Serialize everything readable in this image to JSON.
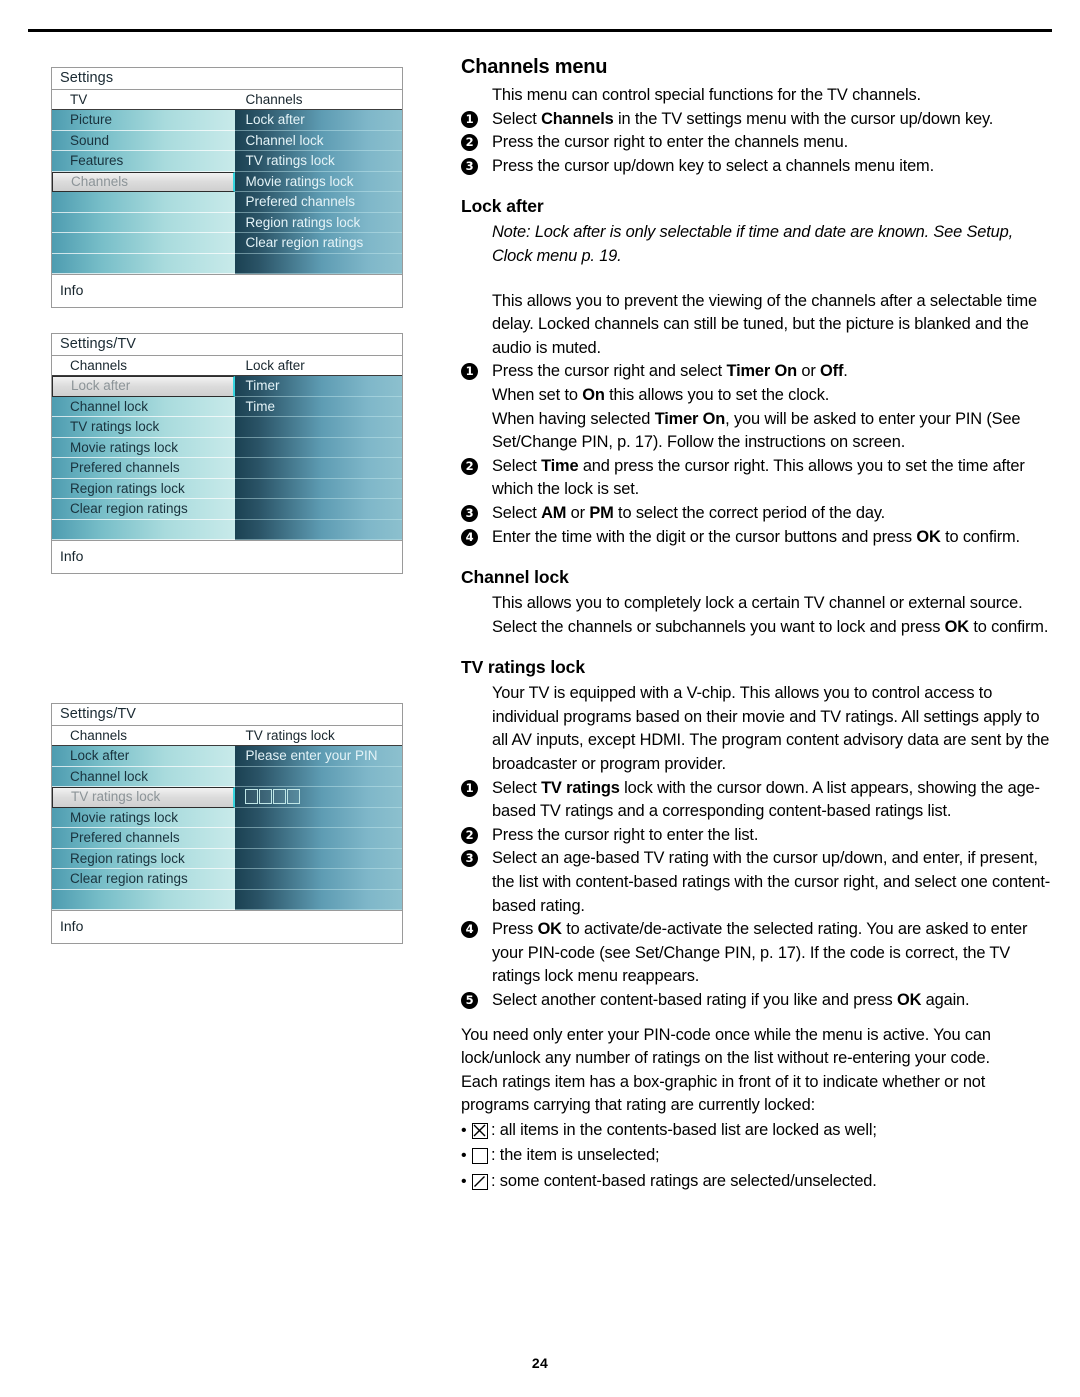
{
  "page": {
    "number": "24"
  },
  "osd_screens": [
    {
      "title": "Settings",
      "left_header": "TV",
      "right_header": "Channels",
      "left_items": [
        "Picture",
        "Sound",
        "Features",
        "Channels",
        "",
        "",
        "",
        ""
      ],
      "left_selected_index": 3,
      "right_items": [
        "Lock after",
        "Channel lock",
        "TV ratings lock",
        "Movie ratings lock",
        "Prefered channels",
        "Region ratings lock",
        "Clear region ratings",
        ""
      ],
      "info_label": "Info"
    },
    {
      "title": "Settings/TV",
      "left_header": "Channels",
      "right_header": "Lock after",
      "left_items": [
        "Lock after",
        "Channel lock",
        "TV ratings lock",
        "Movie ratings lock",
        "Prefered channels",
        "Region ratings lock",
        "Clear region ratings",
        ""
      ],
      "left_selected_index": 0,
      "right_items": [
        "Timer",
        "Time",
        "",
        "",
        "",
        "",
        "",
        ""
      ],
      "info_label": "Info"
    },
    {
      "title": "Settings/TV",
      "left_header": "Channels",
      "right_header": "TV ratings lock",
      "left_items": [
        "Lock after",
        "Channel lock",
        "TV ratings lock",
        "Movie ratings lock",
        "Prefered channels",
        "Region ratings lock",
        "Clear region ratings",
        ""
      ],
      "left_selected_index": 2,
      "right_items": [
        "Please enter your PIN",
        "",
        "PIN_BOXES",
        "",
        "",
        "",
        "",
        ""
      ],
      "pin_box_count": 4,
      "info_label": "Info"
    }
  ],
  "content": {
    "heading": "Channels menu",
    "intro": "This menu can control special functions for the TV channels.",
    "intro_steps": [
      {
        "num": "❶",
        "parts": [
          {
            "t": "Select ",
            "b": false
          },
          {
            "t": "Channels",
            "b": true
          },
          {
            "t": " in the TV settings menu with the cursor up/down key.",
            "b": false
          }
        ]
      },
      {
        "num": "❷",
        "parts": [
          {
            "t": "Press the cursor right to enter the channels menu.",
            "b": false
          }
        ]
      },
      {
        "num": "❸",
        "parts": [
          {
            "t": "Press the cursor up/down key to select a channels menu item.",
            "b": false
          }
        ]
      }
    ],
    "lock_after": {
      "title": "Lock after",
      "note": "Note: Lock after is only selectable if time and date are known. See Setup, Clock menu p. 19.",
      "body": "This allows you to prevent the viewing of the channels after a selectable time delay. Locked channels can still be tuned, but the picture is blanked and the audio is muted.",
      "steps": [
        {
          "num": "❶",
          "parts": [
            {
              "t": "Press the cursor right and select ",
              "b": false
            },
            {
              "t": "Timer On",
              "b": true
            },
            {
              "t": " or ",
              "b": false
            },
            {
              "t": "Off",
              "b": true
            },
            {
              "t": ".",
              "b": false
            },
            {
              "t": "\nWhen set to ",
              "b": false
            },
            {
              "t": "On",
              "b": true
            },
            {
              "t": " this allows you to set the clock.",
              "b": false
            },
            {
              "t": "\nWhen having selected ",
              "b": false
            },
            {
              "t": "Timer On",
              "b": true
            },
            {
              "t": ", you will be asked to enter your PIN (See Set/Change PIN, p. 17). Follow the instructions on screen.",
              "b": false
            }
          ]
        },
        {
          "num": "❷",
          "parts": [
            {
              "t": "Select ",
              "b": false
            },
            {
              "t": "Time",
              "b": true
            },
            {
              "t": " and press the cursor right. This allows you to set the time after which the lock is set.",
              "b": false
            }
          ]
        },
        {
          "num": "❸",
          "parts": [
            {
              "t": "Select ",
              "b": false
            },
            {
              "t": "AM",
              "b": true
            },
            {
              "t": " or ",
              "b": false
            },
            {
              "t": "PM",
              "b": true
            },
            {
              "t": " to select the correct period of the day.",
              "b": false
            }
          ]
        },
        {
          "num": "❹",
          "parts": [
            {
              "t": "Enter the time with the digit or the cursor buttons and press ",
              "b": false
            },
            {
              "t": "OK",
              "b": true
            },
            {
              "t": " to confirm.",
              "b": false
            }
          ]
        }
      ]
    },
    "channel_lock": {
      "title": "Channel lock",
      "parts": [
        {
          "t": "This allows you to completely lock a certain TV channel or external source. Select the channels or subchannels you want to lock and press ",
          "b": false
        },
        {
          "t": "OK",
          "b": true
        },
        {
          "t": " to confirm.",
          "b": false
        }
      ]
    },
    "tv_ratings_lock": {
      "title": "TV ratings lock",
      "body": "Your TV is equipped with a V-chip. This allows you to control access to individual programs based on their movie and TV ratings. All settings apply to all AV inputs, except HDMI. The program content advisory data are sent by the broadcaster or program provider.",
      "steps": [
        {
          "num": "❶",
          "parts": [
            {
              "t": "Select ",
              "b": false
            },
            {
              "t": "TV ratings",
              "b": true
            },
            {
              "t": " lock with the cursor down. A list appears, showing the age-based TV ratings and a corresponding content-based ratings list.",
              "b": false
            }
          ]
        },
        {
          "num": "❷",
          "parts": [
            {
              "t": "Press the cursor right to enter the list.",
              "b": false
            }
          ]
        },
        {
          "num": "❸",
          "parts": [
            {
              "t": "Select an age-based TV rating with the cursor up/down, and enter, if present, the list with content-based ratings with the cursor right, and select one content-based rating.",
              "b": false
            }
          ]
        },
        {
          "num": "❹",
          "parts": [
            {
              "t": "Press ",
              "b": false
            },
            {
              "t": "OK",
              "b": true
            },
            {
              "t": " to activate/de-activate the selected rating. You are asked to enter your PIN-code (see Set/Change PIN, p. 17). If the code is correct, the TV ratings lock menu reappears.",
              "b": false
            }
          ]
        },
        {
          "num": "❺",
          "parts": [
            {
              "t": "Select another content-based rating if you like and press ",
              "b": false
            },
            {
              "t": "OK",
              "b": true
            },
            {
              "t": " again.",
              "b": false
            }
          ]
        }
      ],
      "closing_1": "You need only enter your PIN-code once while the menu is active. You can lock/unlock any number of ratings on the list without re-entering your code.",
      "closing_2": "Each ratings item has a box-graphic in front of it to indicate whether or not programs carrying that rating are currently locked:",
      "bullets": [
        {
          "glyph": "box-x-icon",
          "text": ": all items in the contents-based list are locked as well;"
        },
        {
          "glyph": "box-empty-icon",
          "text": ": the item is unselected;"
        },
        {
          "glyph": "box-slash-icon",
          "text": ": some content-based ratings are selected/unselected."
        }
      ]
    }
  }
}
